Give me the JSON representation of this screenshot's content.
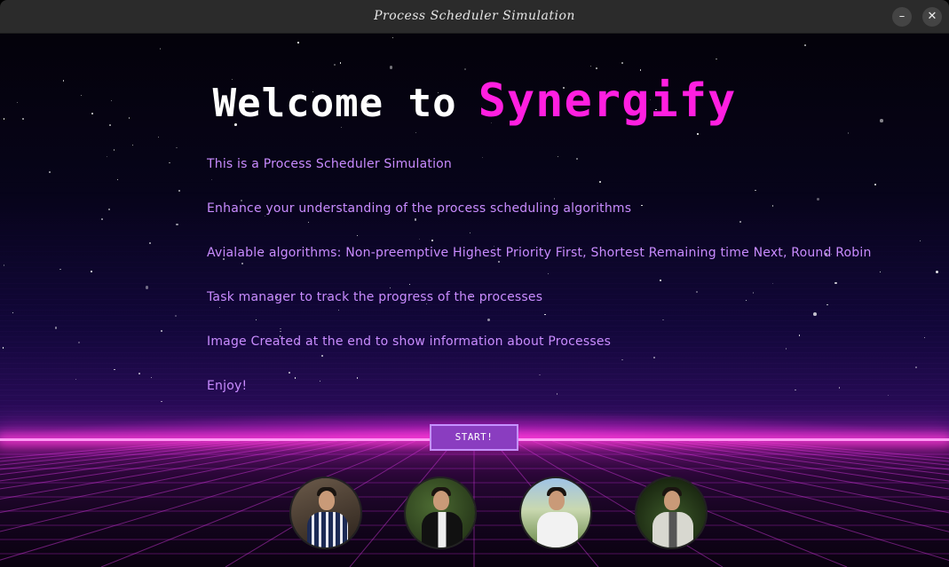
{
  "window": {
    "title": "Process Scheduler Simulation",
    "minimize_label": "–",
    "close_label": "✕"
  },
  "heading": {
    "prefix": "Welcome to",
    "brand": "Synergify"
  },
  "info_lines": [
    "This is a Process Scheduler Simulation",
    "Enhance your understanding of the process scheduling algorithms",
    "Avialable algorithms: Non-preemptive Highest Priority First, Shortest Remaining time Next, Round Robin",
    "Task manager to track the progress of the processes",
    "Image Created at the end to show information about Processes",
    "Enjoy!"
  ],
  "start_button": {
    "label": "START!"
  },
  "avatars": [
    {
      "name": "team-member-1-avatar"
    },
    {
      "name": "team-member-2-avatar"
    },
    {
      "name": "team-member-3-avatar"
    },
    {
      "name": "team-member-4-avatar"
    }
  ],
  "colors": {
    "brand": "#ff1fe0",
    "text": "#c98cff",
    "button": "#8a3dc0",
    "horizon": "#ff3ad6"
  }
}
